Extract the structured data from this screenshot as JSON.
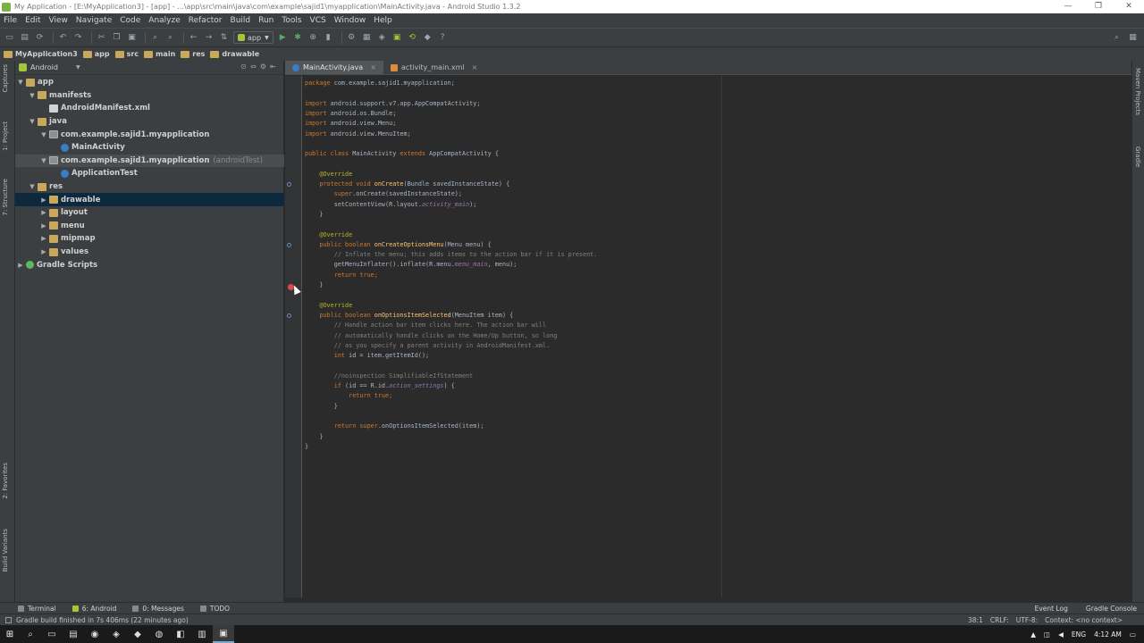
{
  "window": {
    "title": "My Application - [E:\\MyApplication3] - [app] - ...\\app\\src\\main\\java\\com\\example\\sajid1\\myapplication\\MainActivity.java - Android Studio 1.3.2",
    "controls": [
      "—",
      "❐",
      "✕"
    ]
  },
  "menu": [
    "File",
    "Edit",
    "View",
    "Navigate",
    "Code",
    "Analyze",
    "Refactor",
    "Build",
    "Run",
    "Tools",
    "VCS",
    "Window",
    "Help"
  ],
  "toolbar": {
    "run_config": "app"
  },
  "breadcrumb": [
    "MyApplication3",
    "app",
    "src",
    "main",
    "res",
    "drawable"
  ],
  "left_tabs": [
    "1: Project",
    "7: Structure",
    "Captures",
    "2: Favorites",
    "Build Variants"
  ],
  "right_tabs": [
    "Maven Projects",
    "Gradle"
  ],
  "project": {
    "view_label": "Android",
    "tree": [
      {
        "label": "app",
        "depth": 0,
        "icon": "folder",
        "state": "open"
      },
      {
        "label": "manifests",
        "depth": 1,
        "icon": "folder",
        "state": "open"
      },
      {
        "label": "AndroidManifest.xml",
        "depth": 2,
        "icon": "xml",
        "state": "leaf"
      },
      {
        "label": "java",
        "depth": 1,
        "icon": "folder",
        "state": "open"
      },
      {
        "label": "com.example.sajid1.myapplication",
        "depth": 2,
        "icon": "pkg",
        "state": "open"
      },
      {
        "label": "MainActivity",
        "depth": 3,
        "icon": "cls",
        "state": "leaf"
      },
      {
        "label": "com.example.sajid1.myapplication",
        "suffix": "(androidTest)",
        "depth": 2,
        "icon": "pkg",
        "state": "open",
        "hilite": true
      },
      {
        "label": "ApplicationTest",
        "depth": 3,
        "icon": "cls",
        "state": "leaf"
      },
      {
        "label": "res",
        "depth": 1,
        "icon": "folder",
        "state": "open"
      },
      {
        "label": "drawable",
        "depth": 2,
        "icon": "folder",
        "state": "closed",
        "selected": true
      },
      {
        "label": "layout",
        "depth": 2,
        "icon": "folder",
        "state": "closed"
      },
      {
        "label": "menu",
        "depth": 2,
        "icon": "folder",
        "state": "closed"
      },
      {
        "label": "mipmap",
        "depth": 2,
        "icon": "folder",
        "state": "closed"
      },
      {
        "label": "values",
        "depth": 2,
        "icon": "folder",
        "state": "closed"
      },
      {
        "label": "Gradle Scripts",
        "depth": 0,
        "icon": "gradle",
        "state": "closed"
      }
    ]
  },
  "editor": {
    "tabs": [
      {
        "label": "MainActivity.java",
        "active": true,
        "icon": "cls"
      },
      {
        "label": "activity_main.xml",
        "active": false,
        "icon": "xml"
      }
    ],
    "lines": [
      [
        [
          "kw",
          "package "
        ],
        [
          "",
          "com.example.sajid1.myapplication;"
        ]
      ],
      [
        [
          "",
          ""
        ]
      ],
      [
        [
          "kw",
          "import "
        ],
        [
          "",
          "android.support.v7.app.AppCompatActivity;"
        ]
      ],
      [
        [
          "kw",
          "import "
        ],
        [
          "",
          "android.os.Bundle;"
        ]
      ],
      [
        [
          "kw",
          "import "
        ],
        [
          "",
          "android.view.Menu;"
        ]
      ],
      [
        [
          "kw",
          "import "
        ],
        [
          "",
          "android.view.MenuItem;"
        ]
      ],
      [
        [
          "",
          ""
        ]
      ],
      [
        [
          "kw",
          "public class "
        ],
        [
          "",
          "MainActivity "
        ],
        [
          "kw",
          "extends "
        ],
        [
          "",
          "AppCompatActivity {"
        ]
      ],
      [
        [
          "",
          ""
        ]
      ],
      [
        [
          "an",
          "    @Override"
        ]
      ],
      [
        [
          "kw",
          "    protected void "
        ],
        [
          "fn",
          "onCreate"
        ],
        [
          "",
          "(Bundle savedInstanceState) {"
        ]
      ],
      [
        [
          "kw",
          "        super"
        ],
        [
          "",
          ".onCreate(savedInstanceState);"
        ]
      ],
      [
        [
          "",
          "        setContentView(R.layout."
        ],
        [
          "it",
          "activity_main"
        ],
        [
          "",
          ");"
        ]
      ],
      [
        [
          "",
          "    }"
        ]
      ],
      [
        [
          "",
          ""
        ]
      ],
      [
        [
          "an",
          "    @Override"
        ]
      ],
      [
        [
          "kw",
          "    public boolean "
        ],
        [
          "fn",
          "onCreateOptionsMenu"
        ],
        [
          "",
          "(Menu menu) {"
        ]
      ],
      [
        [
          "cm",
          "        // Inflate the menu; this adds items to the action bar if it is present."
        ]
      ],
      [
        [
          "",
          "        getMenuInflater().inflate(R.menu."
        ],
        [
          "it",
          "menu_main"
        ],
        [
          "",
          ", menu);"
        ]
      ],
      [
        [
          "kw",
          "        return true"
        ],
        [
          "kw",
          ";"
        ]
      ],
      [
        [
          "",
          "    }"
        ]
      ],
      [
        [
          "",
          ""
        ]
      ],
      [
        [
          "an",
          "    @Override"
        ]
      ],
      [
        [
          "kw",
          "    public boolean "
        ],
        [
          "fn",
          "onOptionsItemSelected"
        ],
        [
          "",
          "(MenuItem item) {"
        ]
      ],
      [
        [
          "cm",
          "        // Handle action bar item clicks here. The action bar will"
        ]
      ],
      [
        [
          "cm",
          "        // automatically handle clicks on the Home/Up button, so long"
        ]
      ],
      [
        [
          "cm",
          "        // as you specify a parent activity in AndroidManifest.xml."
        ]
      ],
      [
        [
          "kw",
          "        int "
        ],
        [
          "",
          "id = item.getItemId();"
        ]
      ],
      [
        [
          "",
          ""
        ]
      ],
      [
        [
          "cm",
          "        //noinspection SimplifiableIfStatement"
        ]
      ],
      [
        [
          "kw",
          "        if "
        ],
        [
          "",
          "(id == R.id."
        ],
        [
          "it",
          "action_settings"
        ],
        [
          "",
          ") {"
        ]
      ],
      [
        [
          "kw",
          "            return true"
        ],
        [
          "kw",
          ";"
        ]
      ],
      [
        [
          "",
          "        }"
        ]
      ],
      [
        [
          "",
          ""
        ]
      ],
      [
        [
          "kw",
          "        return super"
        ],
        [
          "",
          ".onOptionsItemSelected(item);"
        ]
      ],
      [
        [
          "",
          "    }"
        ]
      ],
      [
        [
          "",
          "}"
        ]
      ]
    ]
  },
  "bottom_tabs": [
    "Terminal",
    "6: Android",
    "0: Messages",
    "TODO"
  ],
  "bottom_right": [
    "Event Log",
    "Gradle Console"
  ],
  "status": {
    "message": "Gradle build finished in 7s 406ms (22 minutes ago)",
    "position": "38:1",
    "line_sep": "CRLF:",
    "encoding": "UTF-8:",
    "context": "Context: <no context>"
  },
  "taskbar": {
    "lang": "ENG",
    "time": "4:12 AM"
  }
}
